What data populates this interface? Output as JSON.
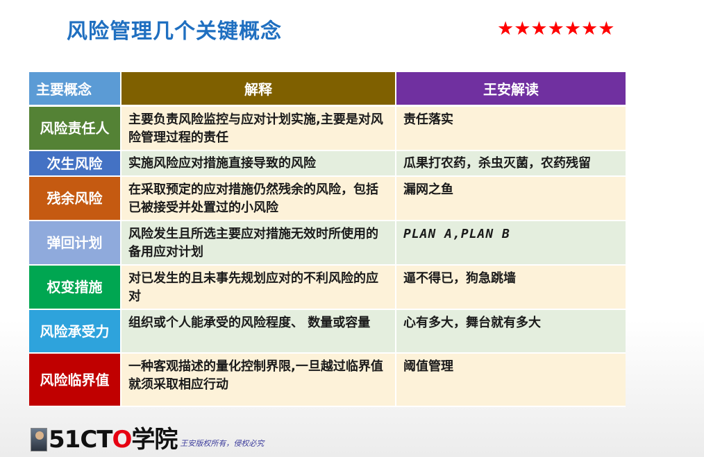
{
  "title": "风险管理几个关键概念",
  "stars": "★★★★★★★",
  "colors": {
    "title": "#1f6fc0",
    "header_concept": "#5b9bd5",
    "header_explain": "#7f6000",
    "header_reading": "#7030a0",
    "row_bg_odd": "#fdf2d9",
    "row_bg_even": "#e4eede"
  },
  "table": {
    "headers": [
      "主要概念",
      "解释",
      "王安解读"
    ],
    "rows": [
      {
        "concept": "风险责任人",
        "color": "#548235",
        "explanation": "主要负责风险监控与应对计划实施,主要是对风险管理过程的责任",
        "reading": "责任落实"
      },
      {
        "concept": "次生风险",
        "color": "#4472c4",
        "explanation": "实施风险应对措施直接导致的风险",
        "reading": "瓜果打农药，杀虫灭菌，农药残留"
      },
      {
        "concept": "残余风险",
        "color": "#c55a11",
        "explanation": "在采取预定的应对措施仍然残余的风险，包括已被接受并处置过的小风险",
        "reading": "漏网之鱼"
      },
      {
        "concept": "弹回计划",
        "color": "#8faadc",
        "explanation": "风险发生且所选主要应对措施无效时所使用的备用应对计划",
        "reading": "PLAN A,PLAN B"
      },
      {
        "concept": "权变措施",
        "color": "#00a651",
        "explanation": "对已发生的且未事先规划应对的不利风险的应对",
        "reading": "逼不得已，狗急跳墙"
      },
      {
        "concept": "风险承受力",
        "color": "#2ea3dc",
        "explanation": "组织或个人能承受的风险程度、 数量或容量",
        "reading": "心有多大，舞台就有多大"
      },
      {
        "concept": "风险临界值",
        "color": "#c00000",
        "explanation": "一种客观描述的量化控制界限,一旦越过临界值就须采取相应行动",
        "reading": "阈值管理"
      }
    ]
  },
  "footer": {
    "brand_prefix": "51CT",
    "brand_o": "O",
    "brand_suffix": "学院",
    "copyright": "王安版权所有，侵权必究"
  }
}
